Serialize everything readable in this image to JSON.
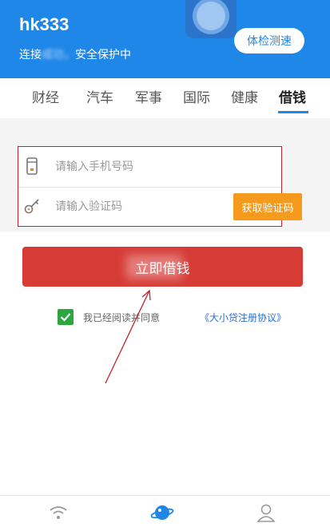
{
  "header": {
    "title": "hk333",
    "subtitle_visible_start": "连接",
    "subtitle_blurred": "成功，",
    "subtitle_visible_end": "安全保护中",
    "check_button": "体检测速"
  },
  "tabs": [
    {
      "label": "财经",
      "active": false
    },
    {
      "label": "汽车",
      "active": false
    },
    {
      "label": "军事",
      "active": false
    },
    {
      "label": "国际",
      "active": false
    },
    {
      "label": "健康",
      "active": false
    },
    {
      "label": "借钱",
      "active": true
    }
  ],
  "form": {
    "phone_placeholder": "请输入手机号码",
    "code_placeholder": "请输入验证码",
    "get_code_button": "获取验证码"
  },
  "main_button": {
    "label": "立即借钱"
  },
  "agreement": {
    "checked": true,
    "text": "我已经阅读并同意",
    "link": "《大小贷注册协议》"
  },
  "bottom_nav": [
    {
      "icon": "wifi-icon"
    },
    {
      "icon": "planet-icon"
    },
    {
      "icon": "user-icon"
    }
  ],
  "colors": {
    "header_bg": "#1f87e8",
    "accent_orange": "#f59a1c",
    "main_button_red": "#d63b36",
    "highlight_box": "#c8202c",
    "checkbox_green": "#2ea640",
    "link_blue": "#2a6fd6"
  }
}
